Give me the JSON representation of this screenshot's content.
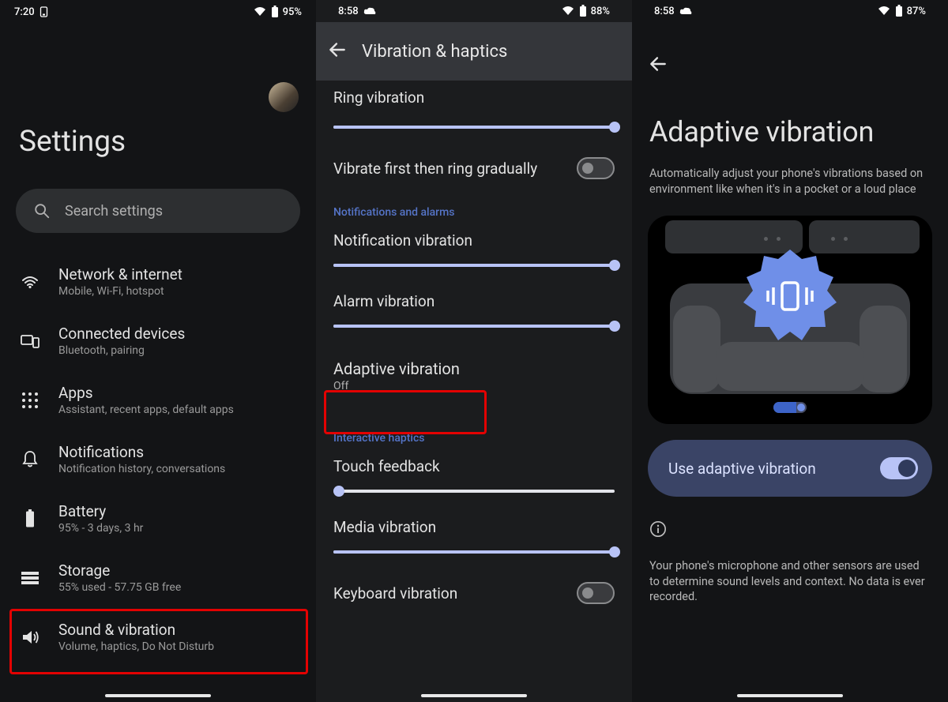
{
  "panel1": {
    "status": {
      "time": "7:20",
      "battery": "95%"
    },
    "title": "Settings",
    "search_placeholder": "Search settings",
    "items": [
      {
        "icon": "wifi",
        "title": "Network & internet",
        "sub": "Mobile, Wi-Fi, hotspot"
      },
      {
        "icon": "devices",
        "title": "Connected devices",
        "sub": "Bluetooth, pairing"
      },
      {
        "icon": "apps",
        "title": "Apps",
        "sub": "Assistant, recent apps, default apps"
      },
      {
        "icon": "bell",
        "title": "Notifications",
        "sub": "Notification history, conversations"
      },
      {
        "icon": "battery",
        "title": "Battery",
        "sub": "95% - 3 days, 3 hr"
      },
      {
        "icon": "storage",
        "title": "Storage",
        "sub": "55% used - 57.75 GB free"
      },
      {
        "icon": "sound",
        "title": "Sound & vibration",
        "sub": "Volume, haptics, Do Not Disturb",
        "highlight": true
      }
    ]
  },
  "panel2": {
    "status": {
      "time": "8:58",
      "battery": "88%"
    },
    "header_title": "Vibration & haptics",
    "ring_vibration": {
      "label": "Ring vibration",
      "value": 100
    },
    "vibrate_first": {
      "label": "Vibrate first then ring gradually",
      "on": false
    },
    "section_notif": "Notifications and alarms",
    "notification_vibration": {
      "label": "Notification vibration",
      "value": 100
    },
    "alarm_vibration": {
      "label": "Alarm vibration",
      "value": 100
    },
    "adaptive": {
      "label": "Adaptive vibration",
      "sub": "Off",
      "highlight": true
    },
    "section_interactive": "Interactive haptics",
    "touch_feedback": {
      "label": "Touch feedback",
      "value": 2
    },
    "media_vibration": {
      "label": "Media vibration",
      "value": 100
    },
    "keyboard_vibration": {
      "label": "Keyboard vibration",
      "on": false
    }
  },
  "panel3": {
    "status": {
      "time": "8:58",
      "battery": "87%"
    },
    "title": "Adaptive vibration",
    "subtitle": "Automatically adjust your phone's vibrations based on environment like when it's in a pocket or a loud place",
    "use_label": "Use adaptive vibration",
    "use_on": true,
    "note": "Your phone's microphone and other sensors are used to determine sound levels and context. No data is ever recorded."
  }
}
